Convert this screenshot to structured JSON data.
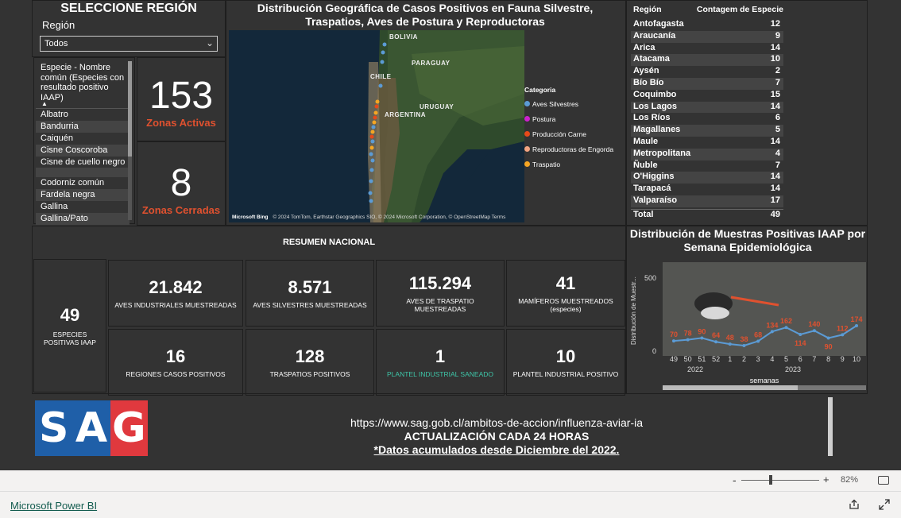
{
  "selector": {
    "title": "SELECCIONE REGIÓN",
    "label": "Región",
    "value": "Todos"
  },
  "species": {
    "header": "Especie - Nombre común (Especies con resultado positivo IAAP)",
    "items": [
      "Albatro",
      "Bandurria",
      "Caiquén",
      "Cisne Coscoroba",
      "Cisne de cuello negro",
      "",
      "Codorniz común",
      "Fardela negra",
      "Gallina",
      "Gallina/Pato"
    ]
  },
  "kpis": {
    "active": {
      "value": "153",
      "label": "Zonas Activas"
    },
    "closed": {
      "value": "8",
      "label": "Zonas Cerradas"
    }
  },
  "map": {
    "title": "Distribución Geográfica de Casos Positivos en Fauna Silvestre, Traspatios, Aves de Postura y Reproductoras",
    "labels": {
      "bolivia": "BOLIVIA",
      "paraguay": "PARAGUAY",
      "chile": "CHILE",
      "uruguay": "URUGUAY",
      "argentina": "ARGENTINA"
    },
    "attribution": "© 2024 TomTom, Earthstar Geographics SIO, © 2024 Microsoft Corporation, © OpenStreetMap  Terms",
    "ms_logo": "Microsoft Bing",
    "legend_title": "Categoria",
    "legend": [
      {
        "label": "Aves Silvestres",
        "color": "#5b9bd5"
      },
      {
        "label": "Postura",
        "color": "#cc22cc"
      },
      {
        "label": "Producción Carne",
        "color": "#e64a19"
      },
      {
        "label": "Reproductoras de Engorda",
        "color": "#f4a582"
      },
      {
        "label": "Traspatio",
        "color": "#f5a623"
      }
    ]
  },
  "region_table": {
    "col1": "Región",
    "col2": "Contagem de Especie",
    "rows": [
      {
        "region": "Antofagasta",
        "count": "12"
      },
      {
        "region": "Araucanía",
        "count": "9"
      },
      {
        "region": "Arica",
        "count": "14"
      },
      {
        "region": "Atacama",
        "count": "10"
      },
      {
        "region": "Aysén",
        "count": "2"
      },
      {
        "region": "Bío Bío",
        "count": "7"
      },
      {
        "region": "Coquimbo",
        "count": "15"
      },
      {
        "region": "Los Lagos",
        "count": "14"
      },
      {
        "region": "Los Ríos",
        "count": "6"
      },
      {
        "region": "Magallanes",
        "count": "5"
      },
      {
        "region": "Maule",
        "count": "14"
      },
      {
        "region": "Metropolitana",
        "count": "4"
      },
      {
        "region": "Ñuble",
        "count": "7"
      },
      {
        "region": "O'Higgins",
        "count": "14"
      },
      {
        "region": "Tarapacá",
        "count": "14"
      },
      {
        "region": "Valparaíso",
        "count": "17"
      }
    ],
    "total_label": "Total",
    "total": "49"
  },
  "resumen": {
    "title": "RESUMEN NACIONAL",
    "species": {
      "value": "49",
      "label": "ESPECIES POSITIVAS IAAP"
    },
    "cards": [
      {
        "value": "21.842",
        "label": "AVES INDUSTRIALES MUESTREADAS"
      },
      {
        "value": "8.571",
        "label": "AVES SILVESTRES MUESTREADAS"
      },
      {
        "value": "115.294",
        "label": "AVES DE TRASPATIO MUESTREADAS"
      },
      {
        "value": "41",
        "label": "MAMÍFEROS MUESTREADOS (especies)"
      },
      {
        "value": "16",
        "label": "REGIONES CASOS POSITIVOS"
      },
      {
        "value": "128",
        "label": "TRASPATIOS POSITIVOS"
      },
      {
        "value": "1",
        "label": "PLANTEL INDUSTRIAL SANEADO"
      },
      {
        "value": "10",
        "label": "PLANTEL INDUSTRIAL POSITIVO"
      }
    ],
    "highlight_color": "#3ec6a8"
  },
  "chart_data": {
    "type": "line",
    "title": "Distribución de Muestras Positivas IAAP por Semana Epidemiológica",
    "ylabel": "Distribución de Muestr...",
    "xlabel": "semanas",
    "categories": [
      "49",
      "50",
      "51",
      "52",
      "1",
      "2",
      "3",
      "4",
      "5",
      "6",
      "7",
      "8",
      "9",
      "10"
    ],
    "values": [
      70,
      78,
      90,
      64,
      48,
      38,
      68,
      134,
      162,
      114,
      140,
      90,
      112,
      174
    ],
    "year_labels": [
      "2022",
      "2023"
    ],
    "ylim": [
      0,
      500
    ],
    "yticks": [
      "500",
      "0"
    ],
    "line_color": "#5b9bd5",
    "label_color": "#e0512f"
  },
  "footer": {
    "url": "https://www.sag.gob.cl/ambitos-de-accion/influenza-aviar-ia",
    "update": "ACTUALIZACIÓN CADA 24 HORAS",
    "note": "*Datos acumulados desde Diciembre del 2022.",
    "logo": [
      "S",
      "A",
      "G"
    ]
  },
  "app": {
    "zoom": "82%",
    "product": "Microsoft Power BI",
    "zoom_minus": "-",
    "zoom_plus": "+"
  }
}
